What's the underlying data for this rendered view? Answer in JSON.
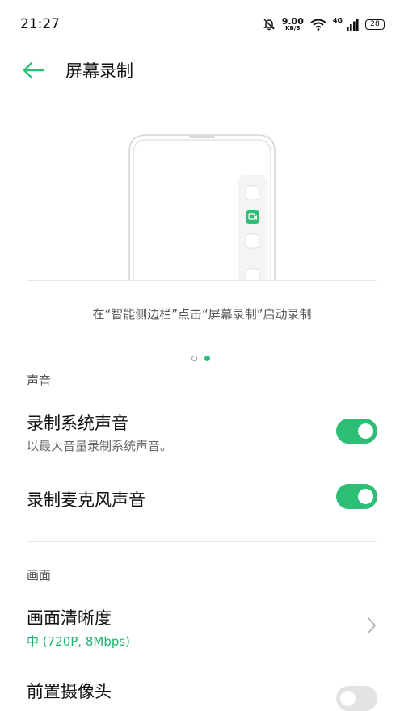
{
  "status_bar": {
    "time": "21:27",
    "net_speed_value": "9.00",
    "net_speed_unit": "KB/S",
    "network_type": "4G",
    "battery": "28",
    "icons": [
      "mute-bell-icon",
      "wifi-icon",
      "signal-icon",
      "battery-icon"
    ]
  },
  "header": {
    "title": "屏幕录制",
    "back_icon": "arrow-left-icon"
  },
  "preview": {
    "caption": "在“智能侧边栏”点击“屏幕录制”启动录制",
    "pager": {
      "count": 2,
      "active_index": 1
    }
  },
  "sections": {
    "sound": {
      "header": "声音",
      "system_audio": {
        "title": "录制系统声音",
        "subtitle": "以最大音量录制系统声音。",
        "enabled": true
      },
      "mic_audio": {
        "title": "录制麦克风声音",
        "enabled": true
      }
    },
    "video": {
      "header": "画面",
      "resolution": {
        "title": "画面清晰度",
        "value": "中 (720P, 8Mbps)"
      },
      "front_camera": {
        "title": "前置摄像头",
        "enabled": false
      }
    }
  },
  "colors": {
    "accent": "#2ebf77",
    "accent_text": "#1fb16c",
    "toggle_off": "#e3e3e3",
    "divider": "#e6e6e6"
  }
}
